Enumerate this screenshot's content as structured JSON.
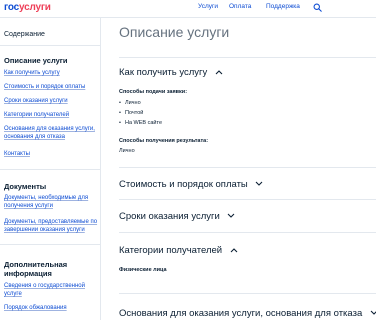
{
  "header": {
    "logo_part1": "гос",
    "logo_part2": "услуги",
    "nav": [
      "Услуги",
      "Оплата",
      "Поддержка"
    ]
  },
  "sidebar": {
    "title": "Содержание",
    "group1": {
      "heading": "Описание услуги",
      "links": [
        "Как получить услугу",
        "Стоимость и порядок оплаты",
        "Сроки оказания услуги",
        "Категории получателей",
        "Основания для оказания услуги, основания для отказа",
        "Контакты"
      ]
    },
    "group2": {
      "heading": "Документы",
      "links": [
        "Документы, необходимые для получения услуги",
        "Документы, предоставляемые по завершении оказания услуги"
      ]
    },
    "group3": {
      "heading": "Дополнительная информация",
      "links": [
        "Сведения о государственной услуге",
        "Порядок обжалования"
      ]
    }
  },
  "main": {
    "title": "Описание услуги",
    "sections": [
      {
        "heading": "Как получить услугу",
        "expanded": true,
        "submit_label": "Способы подачи заявки:",
        "submit_items": [
          "Лично",
          "Почтой",
          "На WEB сайте"
        ],
        "result_label": "Способы получения результата:",
        "result_value": "Лично"
      },
      {
        "heading": "Стоимость и порядок оплаты",
        "expanded": false
      },
      {
        "heading": "Сроки оказания услуги",
        "expanded": false
      },
      {
        "heading": "Категории получателей",
        "expanded": true,
        "content": "Физические лица"
      },
      {
        "heading": "Основания для оказания услуги, основания для отказа",
        "expanded": false
      }
    ]
  },
  "colors": {
    "brand_blue": "#0d4cd3",
    "brand_red": "#ee3f58",
    "text": "#0b1f33",
    "muted_title": "#66727f",
    "divider": "#e3e8ee"
  },
  "icons": [
    "search-icon",
    "chevron-up-icon",
    "chevron-down-icon"
  ]
}
